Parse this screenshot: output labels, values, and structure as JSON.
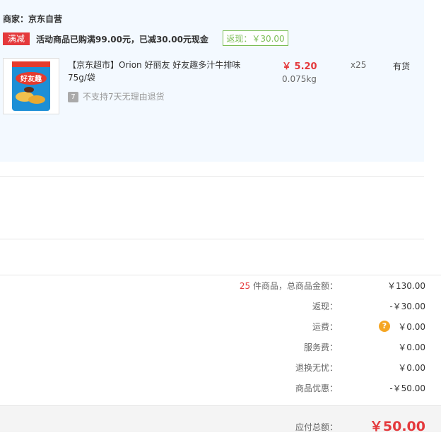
{
  "merchant": {
    "label": "商家：京东自营"
  },
  "promo": {
    "badge": "满减",
    "text": "活动商品已购满99.00元，已减30.00元现金",
    "cashback_tag": "返现：￥30.00"
  },
  "item": {
    "title": "【京东超市】Orion 好丽友 好友趣多汁牛排味 75g/袋",
    "no_return": "不支持7天无理由退货",
    "no_return_icon": "7",
    "price": "￥ 5.20",
    "weight": "0.075kg",
    "qty": "x25",
    "stock": "有货",
    "image_brand": "好友趣"
  },
  "summary": {
    "count": "25",
    "goods_label": " 件商品，总商品金额：",
    "goods_value": "￥130.00",
    "cashback_label": "返现：",
    "cashback_value": "-￥30.00",
    "shipping_label": "运费：",
    "shipping_value": "￥0.00",
    "service_label": "服务费：",
    "service_value": "￥0.00",
    "returns_label": "退换无忧：",
    "returns_value": "￥0.00",
    "discount_label": "商品优惠：",
    "discount_value": "-￥50.00",
    "total_label": "应付总额：",
    "total_value": "￥50.00"
  },
  "colors": {
    "accent_red": "#e4393c",
    "green": "#7abd54",
    "orange": "#ff6a00"
  }
}
